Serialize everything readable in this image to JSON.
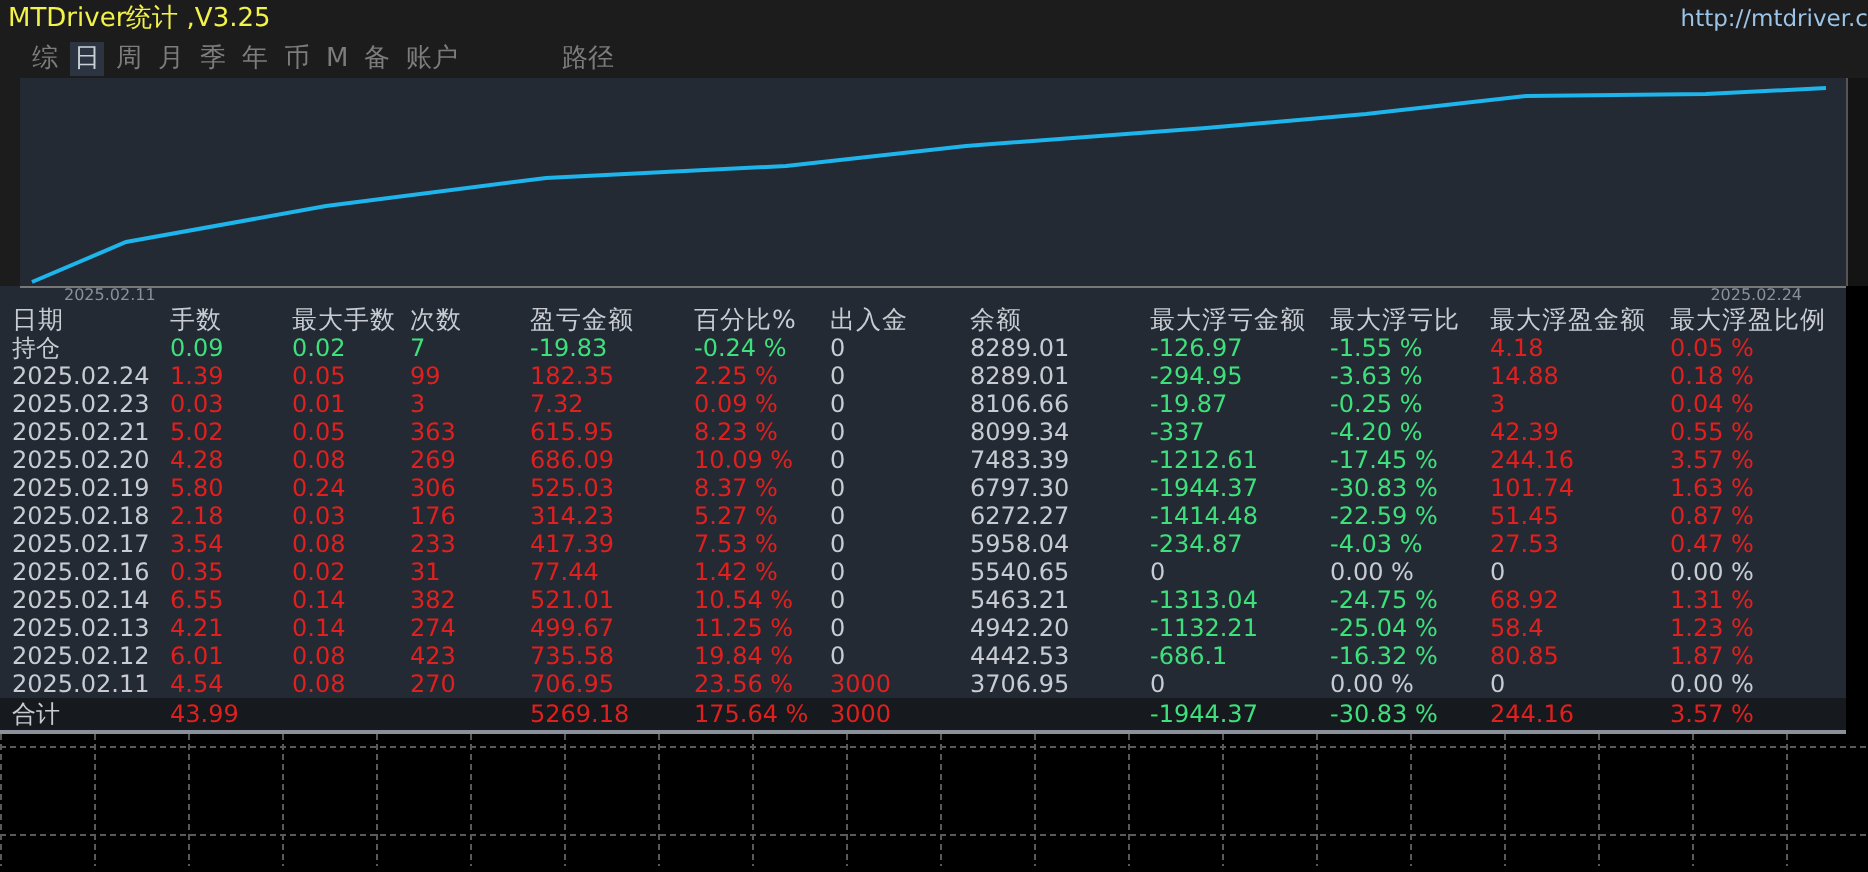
{
  "title": "MTDriver统计 ,V3.25",
  "url": "http://mtdriver.c",
  "tabs": [
    {
      "label": "综",
      "selected": false
    },
    {
      "label": "日",
      "selected": true
    },
    {
      "label": "周",
      "selected": false
    },
    {
      "label": "月",
      "selected": false
    },
    {
      "label": "季",
      "selected": false
    },
    {
      "label": "年",
      "selected": false
    },
    {
      "label": "币",
      "selected": false
    },
    {
      "label": "M",
      "selected": false
    },
    {
      "label": "备",
      "selected": false
    },
    {
      "label": "账户",
      "selected": false
    },
    {
      "label": "路径",
      "selected": false
    }
  ],
  "chart": {
    "x_start_label": "2025.02.11",
    "x_end_label": "2025.02.24"
  },
  "table": {
    "columns": [
      "日期",
      "手数",
      "最大手数",
      "次数",
      "盈亏金额",
      "百分比%",
      "出入金",
      "余额",
      "最大浮亏金额",
      "最大浮亏比",
      "最大浮盈金额",
      "最大浮盈比例"
    ],
    "rows": [
      [
        {
          "text": "持仓",
          "color": "#c8ccd2"
        },
        {
          "text": "0.09",
          "color": "#3ee07c"
        },
        {
          "text": "0.02",
          "color": "#3ee07c"
        },
        {
          "text": "7",
          "color": "#3ee07c"
        },
        {
          "text": "-19.83",
          "color": "#3ee07c"
        },
        {
          "text": "-0.24 %",
          "color": "#3ee07c"
        },
        {
          "text": "0",
          "color": "#c8ccd2"
        },
        {
          "text": "8289.01",
          "color": "#c8ccd2"
        },
        {
          "text": "-126.97",
          "color": "#3ee07c"
        },
        {
          "text": "-1.55 %",
          "color": "#3ee07c"
        },
        {
          "text": "4.18",
          "color": "#e0201e"
        },
        {
          "text": "0.05 %",
          "color": "#e0201e"
        }
      ],
      [
        {
          "text": "2025.02.24",
          "color": "#c8ccd2"
        },
        {
          "text": "1.39",
          "color": "#e0201e"
        },
        {
          "text": "0.05",
          "color": "#e0201e"
        },
        {
          "text": "99",
          "color": "#e0201e"
        },
        {
          "text": "182.35",
          "color": "#e0201e"
        },
        {
          "text": "2.25 %",
          "color": "#e0201e"
        },
        {
          "text": "0",
          "color": "#c8ccd2"
        },
        {
          "text": "8289.01",
          "color": "#c8ccd2"
        },
        {
          "text": "-294.95",
          "color": "#3ee07c"
        },
        {
          "text": "-3.63 %",
          "color": "#3ee07c"
        },
        {
          "text": "14.88",
          "color": "#e0201e"
        },
        {
          "text": "0.18 %",
          "color": "#e0201e"
        }
      ],
      [
        {
          "text": "2025.02.23",
          "color": "#c8ccd2"
        },
        {
          "text": "0.03",
          "color": "#e0201e"
        },
        {
          "text": "0.01",
          "color": "#e0201e"
        },
        {
          "text": "3",
          "color": "#e0201e"
        },
        {
          "text": "7.32",
          "color": "#e0201e"
        },
        {
          "text": "0.09 %",
          "color": "#e0201e"
        },
        {
          "text": "0",
          "color": "#c8ccd2"
        },
        {
          "text": "8106.66",
          "color": "#c8ccd2"
        },
        {
          "text": "-19.87",
          "color": "#3ee07c"
        },
        {
          "text": "-0.25 %",
          "color": "#3ee07c"
        },
        {
          "text": "3",
          "color": "#e0201e"
        },
        {
          "text": "0.04 %",
          "color": "#e0201e"
        }
      ],
      [
        {
          "text": "2025.02.21",
          "color": "#c8ccd2"
        },
        {
          "text": "5.02",
          "color": "#e0201e"
        },
        {
          "text": "0.05",
          "color": "#e0201e"
        },
        {
          "text": "363",
          "color": "#e0201e"
        },
        {
          "text": "615.95",
          "color": "#e0201e"
        },
        {
          "text": "8.23 %",
          "color": "#e0201e"
        },
        {
          "text": "0",
          "color": "#c8ccd2"
        },
        {
          "text": "8099.34",
          "color": "#c8ccd2"
        },
        {
          "text": "-337",
          "color": "#3ee07c"
        },
        {
          "text": "-4.20 %",
          "color": "#3ee07c"
        },
        {
          "text": "42.39",
          "color": "#e0201e"
        },
        {
          "text": "0.55 %",
          "color": "#e0201e"
        }
      ],
      [
        {
          "text": "2025.02.20",
          "color": "#c8ccd2"
        },
        {
          "text": "4.28",
          "color": "#e0201e"
        },
        {
          "text": "0.08",
          "color": "#e0201e"
        },
        {
          "text": "269",
          "color": "#e0201e"
        },
        {
          "text": "686.09",
          "color": "#e0201e"
        },
        {
          "text": "10.09 %",
          "color": "#e0201e"
        },
        {
          "text": "0",
          "color": "#c8ccd2"
        },
        {
          "text": "7483.39",
          "color": "#c8ccd2"
        },
        {
          "text": "-1212.61",
          "color": "#3ee07c"
        },
        {
          "text": "-17.45 %",
          "color": "#3ee07c"
        },
        {
          "text": "244.16",
          "color": "#e0201e"
        },
        {
          "text": "3.57 %",
          "color": "#e0201e"
        }
      ],
      [
        {
          "text": "2025.02.19",
          "color": "#c8ccd2"
        },
        {
          "text": "5.80",
          "color": "#e0201e"
        },
        {
          "text": "0.24",
          "color": "#e0201e"
        },
        {
          "text": "306",
          "color": "#e0201e"
        },
        {
          "text": "525.03",
          "color": "#e0201e"
        },
        {
          "text": "8.37 %",
          "color": "#e0201e"
        },
        {
          "text": "0",
          "color": "#c8ccd2"
        },
        {
          "text": "6797.30",
          "color": "#c8ccd2"
        },
        {
          "text": "-1944.37",
          "color": "#3ee07c"
        },
        {
          "text": "-30.83 %",
          "color": "#3ee07c"
        },
        {
          "text": "101.74",
          "color": "#e0201e"
        },
        {
          "text": "1.63 %",
          "color": "#e0201e"
        }
      ],
      [
        {
          "text": "2025.02.18",
          "color": "#c8ccd2"
        },
        {
          "text": "2.18",
          "color": "#e0201e"
        },
        {
          "text": "0.03",
          "color": "#e0201e"
        },
        {
          "text": "176",
          "color": "#e0201e"
        },
        {
          "text": "314.23",
          "color": "#e0201e"
        },
        {
          "text": "5.27 %",
          "color": "#e0201e"
        },
        {
          "text": "0",
          "color": "#c8ccd2"
        },
        {
          "text": "6272.27",
          "color": "#c8ccd2"
        },
        {
          "text": "-1414.48",
          "color": "#3ee07c"
        },
        {
          "text": "-22.59 %",
          "color": "#3ee07c"
        },
        {
          "text": "51.45",
          "color": "#e0201e"
        },
        {
          "text": "0.87 %",
          "color": "#e0201e"
        }
      ],
      [
        {
          "text": "2025.02.17",
          "color": "#c8ccd2"
        },
        {
          "text": "3.54",
          "color": "#e0201e"
        },
        {
          "text": "0.08",
          "color": "#e0201e"
        },
        {
          "text": "233",
          "color": "#e0201e"
        },
        {
          "text": "417.39",
          "color": "#e0201e"
        },
        {
          "text": "7.53 %",
          "color": "#e0201e"
        },
        {
          "text": "0",
          "color": "#c8ccd2"
        },
        {
          "text": "5958.04",
          "color": "#c8ccd2"
        },
        {
          "text": "-234.87",
          "color": "#3ee07c"
        },
        {
          "text": "-4.03 %",
          "color": "#3ee07c"
        },
        {
          "text": "27.53",
          "color": "#e0201e"
        },
        {
          "text": "0.47 %",
          "color": "#e0201e"
        }
      ],
      [
        {
          "text": "2025.02.16",
          "color": "#c8ccd2"
        },
        {
          "text": "0.35",
          "color": "#e0201e"
        },
        {
          "text": "0.02",
          "color": "#e0201e"
        },
        {
          "text": "31",
          "color": "#e0201e"
        },
        {
          "text": "77.44",
          "color": "#e0201e"
        },
        {
          "text": "1.42 %",
          "color": "#e0201e"
        },
        {
          "text": "0",
          "color": "#c8ccd2"
        },
        {
          "text": "5540.65",
          "color": "#c8ccd2"
        },
        {
          "text": "0",
          "color": "#c8ccd2"
        },
        {
          "text": "0.00 %",
          "color": "#c8ccd2"
        },
        {
          "text": "0",
          "color": "#c8ccd2"
        },
        {
          "text": "0.00 %",
          "color": "#c8ccd2"
        }
      ],
      [
        {
          "text": "2025.02.14",
          "color": "#c8ccd2"
        },
        {
          "text": "6.55",
          "color": "#e0201e"
        },
        {
          "text": "0.14",
          "color": "#e0201e"
        },
        {
          "text": "382",
          "color": "#e0201e"
        },
        {
          "text": "521.01",
          "color": "#e0201e"
        },
        {
          "text": "10.54 %",
          "color": "#e0201e"
        },
        {
          "text": "0",
          "color": "#c8ccd2"
        },
        {
          "text": "5463.21",
          "color": "#c8ccd2"
        },
        {
          "text": "-1313.04",
          "color": "#3ee07c"
        },
        {
          "text": "-24.75 %",
          "color": "#3ee07c"
        },
        {
          "text": "68.92",
          "color": "#e0201e"
        },
        {
          "text": "1.31 %",
          "color": "#e0201e"
        }
      ],
      [
        {
          "text": "2025.02.13",
          "color": "#c8ccd2"
        },
        {
          "text": "4.21",
          "color": "#e0201e"
        },
        {
          "text": "0.14",
          "color": "#e0201e"
        },
        {
          "text": "274",
          "color": "#e0201e"
        },
        {
          "text": "499.67",
          "color": "#e0201e"
        },
        {
          "text": "11.25 %",
          "color": "#e0201e"
        },
        {
          "text": "0",
          "color": "#c8ccd2"
        },
        {
          "text": "4942.20",
          "color": "#c8ccd2"
        },
        {
          "text": "-1132.21",
          "color": "#3ee07c"
        },
        {
          "text": "-25.04 %",
          "color": "#3ee07c"
        },
        {
          "text": "58.4",
          "color": "#e0201e"
        },
        {
          "text": "1.23 %",
          "color": "#e0201e"
        }
      ],
      [
        {
          "text": "2025.02.12",
          "color": "#c8ccd2"
        },
        {
          "text": "6.01",
          "color": "#e0201e"
        },
        {
          "text": "0.08",
          "color": "#e0201e"
        },
        {
          "text": "423",
          "color": "#e0201e"
        },
        {
          "text": "735.58",
          "color": "#e0201e"
        },
        {
          "text": "19.84 %",
          "color": "#e0201e"
        },
        {
          "text": "0",
          "color": "#c8ccd2"
        },
        {
          "text": "4442.53",
          "color": "#c8ccd2"
        },
        {
          "text": "-686.1",
          "color": "#3ee07c"
        },
        {
          "text": "-16.32 %",
          "color": "#3ee07c"
        },
        {
          "text": "80.85",
          "color": "#e0201e"
        },
        {
          "text": "1.87 %",
          "color": "#e0201e"
        }
      ],
      [
        {
          "text": "2025.02.11",
          "color": "#c8ccd2"
        },
        {
          "text": "4.54",
          "color": "#e0201e"
        },
        {
          "text": "0.08",
          "color": "#e0201e"
        },
        {
          "text": "270",
          "color": "#e0201e"
        },
        {
          "text": "706.95",
          "color": "#e0201e"
        },
        {
          "text": "23.56 %",
          "color": "#e0201e"
        },
        {
          "text": "3000",
          "color": "#e0201e"
        },
        {
          "text": "3706.95",
          "color": "#c8ccd2"
        },
        {
          "text": "0",
          "color": "#c8ccd2"
        },
        {
          "text": "0.00 %",
          "color": "#c8ccd2"
        },
        {
          "text": "0",
          "color": "#c8ccd2"
        },
        {
          "text": "0.00 %",
          "color": "#c8ccd2"
        }
      ]
    ],
    "total": {
      "label": {
        "text": "合计",
        "color": "#c8ccd2"
      },
      "lots": {
        "text": "43.99",
        "color": "#e0201e"
      },
      "pnl": {
        "text": "5269.18",
        "color": "#e0201e"
      },
      "pct": {
        "text": "175.64 %",
        "color": "#e0201e"
      },
      "deposit": {
        "text": "3000",
        "color": "#e0201e"
      },
      "max_float_loss": {
        "text": "-1944.37",
        "color": "#3ee07c"
      },
      "max_float_loss_pct": {
        "text": "-30.83 %",
        "color": "#3ee07c"
      },
      "max_float_profit": {
        "text": "244.16",
        "color": "#e0201e"
      },
      "max_float_profit_pct": {
        "text": "3.57 %",
        "color": "#e0201e"
      }
    }
  }
}
